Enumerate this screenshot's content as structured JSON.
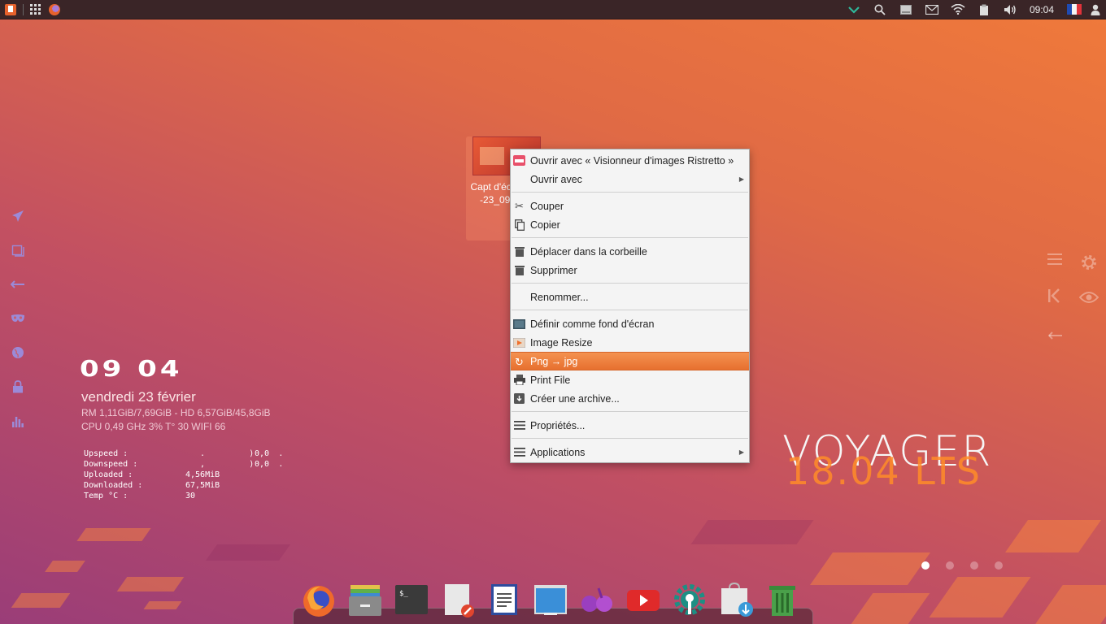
{
  "top_panel": {
    "clock": "09:04"
  },
  "conky": {
    "clock_hours": "09",
    "clock_minutes": "04",
    "date": "vendredi 23 février",
    "line_mem": "RM 1,11GiB/7,69GiB - HD 6,57GiB/45,8GiB",
    "line_cpu": "CPU 0,49 GHz 3% T° 30  WIFI 66",
    "net": [
      {
        "key": "Upspeed :",
        "graph": "   .         )     .",
        "value": "0,0"
      },
      {
        "key": "Downspeed :",
        "graph": "   ,         )     .",
        "value": "0,0"
      },
      {
        "key": "Uploaded :",
        "graph": "",
        "value": "4,56MiB"
      },
      {
        "key": "Downloaded :",
        "graph": "",
        "value": "67,5MiB"
      },
      {
        "key": "Temp °C :",
        "graph": "",
        "value": "30"
      }
    ]
  },
  "desktop_icon": {
    "label": "Capt d'écran_2 -23_09-0 g"
  },
  "context_menu": {
    "items": [
      {
        "label": "Ouvrir avec « Visionneur d'images Ristretto »",
        "icon": "image-viewer-icon"
      },
      {
        "label": "Ouvrir avec",
        "icon": "",
        "submenu": true
      },
      {
        "label": "Couper",
        "icon": "scissors-icon"
      },
      {
        "label": "Copier",
        "icon": "copy-icon"
      },
      {
        "label": "Déplacer dans la corbeille",
        "icon": "trash-icon"
      },
      {
        "label": "Supprimer",
        "icon": "delete-icon"
      },
      {
        "label": "Renommer...",
        "icon": ""
      },
      {
        "label": "Définir comme fond d'écran",
        "icon": "wallpaper-icon"
      },
      {
        "label": "Image Resize",
        "icon": "image-resize-icon"
      },
      {
        "label": "Png → jpg",
        "icon": "convert-icon",
        "active": true
      },
      {
        "label": "Print File",
        "icon": "printer-icon"
      },
      {
        "label": "Créer une archive...",
        "icon": "archive-icon"
      },
      {
        "label": "Propriétés...",
        "icon": "properties-icon"
      },
      {
        "label": "Applications",
        "icon": "applications-icon",
        "submenu": true
      }
    ]
  },
  "branding": {
    "title": "VOYAGER",
    "version": "18.04 LTS"
  },
  "workspaces": {
    "count": 4,
    "active": 1
  },
  "colors": {
    "accent": "#e7702f",
    "panel": "#3a2527",
    "launcher_icons": "#9b8ad8"
  }
}
